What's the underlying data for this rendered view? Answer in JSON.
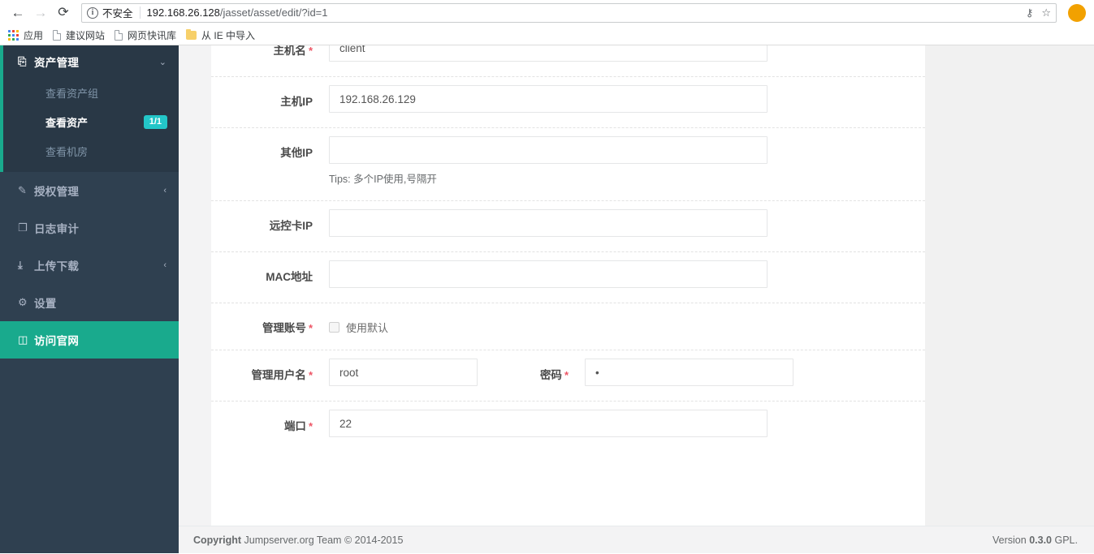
{
  "browser": {
    "back_icon": "back-arrow-icon",
    "forward_icon": "forward-arrow-icon",
    "reload_icon": "reload-icon",
    "security_label": "不安全",
    "info_glyph": "i",
    "url_host": "192.168.26.128",
    "url_path": "/jasset/asset/edit/?id=1",
    "key_icon": "key-icon",
    "star_icon": "star-icon",
    "bookmarks": [
      {
        "label": "应用",
        "icon": "apps-grid-icon"
      },
      {
        "label": "建议网站",
        "icon": "page-icon"
      },
      {
        "label": "网页快讯库",
        "icon": "page-icon"
      },
      {
        "label": "从 IE 中导入",
        "icon": "folder-icon"
      }
    ]
  },
  "sidebar": {
    "group": {
      "label": "资产管理",
      "icon": "inbox-icon",
      "caret": "⌄",
      "items": [
        {
          "label": "查看资产组",
          "badge": ""
        },
        {
          "label": "查看资产",
          "badge": "1/1"
        },
        {
          "label": "查看机房",
          "badge": ""
        }
      ]
    },
    "items": [
      {
        "label": "授权管理",
        "icon": "edit-square-icon",
        "caret": "‹"
      },
      {
        "label": "日志审计",
        "icon": "copy-icon",
        "caret": ""
      },
      {
        "label": "上传下载",
        "icon": "download-icon",
        "caret": "‹"
      },
      {
        "label": "设置",
        "icon": "gears-icon",
        "caret": ""
      },
      {
        "label": "访问官网",
        "icon": "database-icon",
        "caret": ""
      }
    ]
  },
  "form": {
    "rows": [
      {
        "label": "主机名",
        "required": true,
        "value": "client",
        "placeholder": ""
      },
      {
        "label": "主机IP",
        "required": false,
        "value": "192.168.26.129",
        "placeholder": ""
      },
      {
        "label": "其他IP",
        "required": false,
        "value": "",
        "placeholder": "",
        "tip": "Tips: 多个IP使用,号隔开"
      },
      {
        "label": "远控卡IP",
        "required": false,
        "value": "",
        "placeholder": ""
      },
      {
        "label": "MAC地址",
        "required": false,
        "value": "",
        "placeholder": ""
      }
    ],
    "admin_account": {
      "label": "管理账号",
      "required": true,
      "checkbox_label": "使用默认",
      "checked": false
    },
    "admin_user": {
      "label": "管理用户名",
      "required": true,
      "value": "root"
    },
    "password": {
      "label": "密码",
      "required": true,
      "value": "•"
    },
    "port": {
      "label": "端口",
      "required": true,
      "value": "22"
    },
    "required_mark": "*"
  },
  "footer": {
    "copyright_prefix": "Copyright",
    "copyright_text": "Jumpserver.org Team © 2014-2015",
    "version_label": "Version",
    "version_value": "0.3.0",
    "version_suffix": "GPL."
  },
  "colors": {
    "sidebar_bg": "#2f4050",
    "submenu_bg": "#293846",
    "accent_green": "#19aa8d",
    "badge_teal": "#23c6c8",
    "required_red": "#ed5565"
  }
}
